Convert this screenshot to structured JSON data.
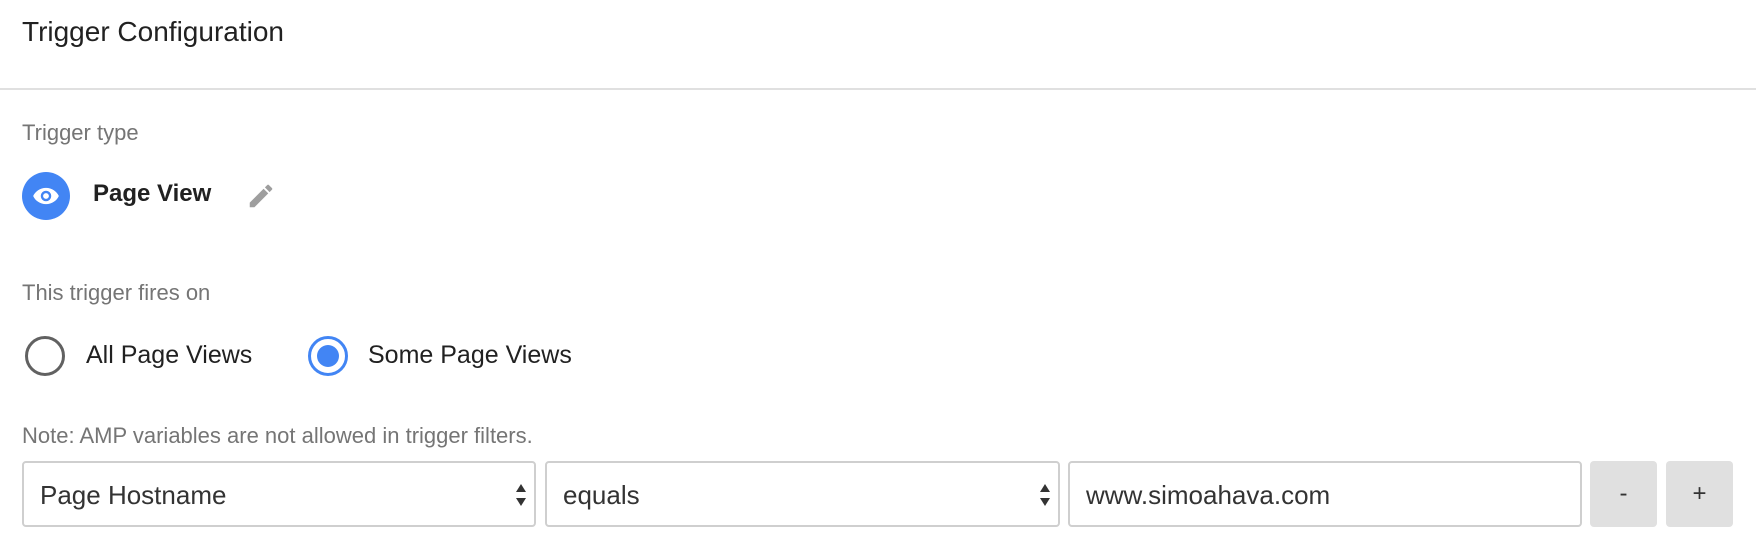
{
  "header": {
    "title": "Trigger Configuration"
  },
  "trigger_type": {
    "label": "Trigger type",
    "name": "Page View",
    "icon": "eye-icon",
    "edit_icon": "pencil-icon",
    "icon_color": "#4285f4"
  },
  "fires_on": {
    "label": "This trigger fires on",
    "options": [
      {
        "label": "All Page Views",
        "selected": false
      },
      {
        "label": "Some Page Views",
        "selected": true
      }
    ]
  },
  "note": "Note: AMP variables are not allowed in trigger filters.",
  "filter": {
    "variable": "Page Hostname",
    "operator": "equals",
    "value": "www.simoahava.com",
    "remove_label": "-",
    "add_label": "+"
  },
  "colors": {
    "accent": "#4285f4",
    "button_bg": "#e0e0e0"
  }
}
